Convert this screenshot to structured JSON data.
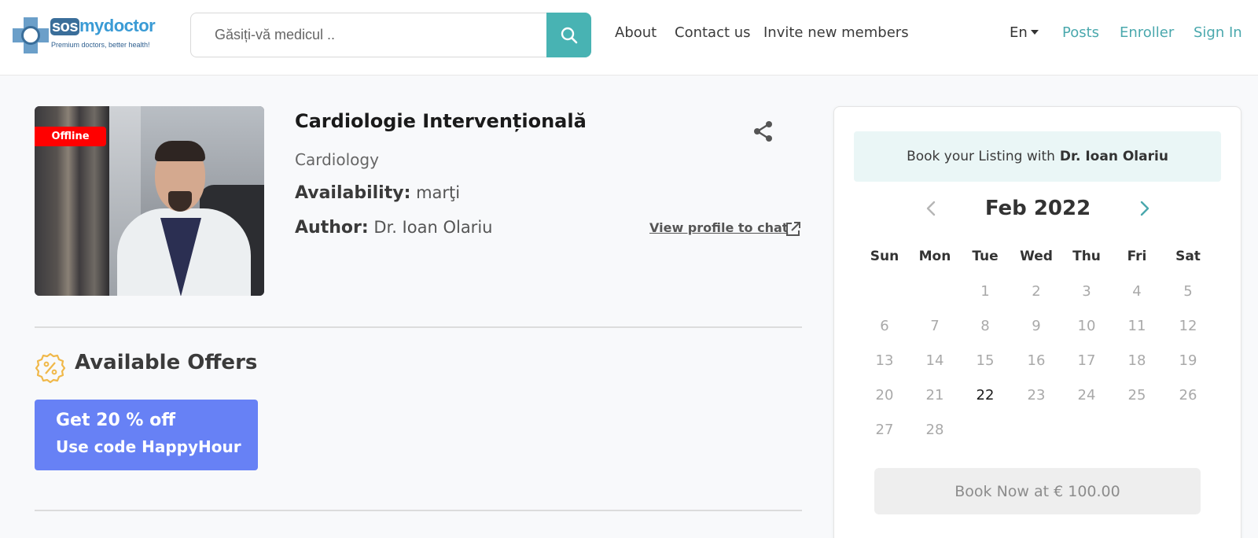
{
  "header": {
    "logo": {
      "brand_sos": "sos",
      "brand_rest": "mydoctor",
      "tagline": "Premium doctors, better health!"
    },
    "search": {
      "placeholder": "Găsiți-vă medicul .."
    },
    "nav": {
      "about": "About",
      "contact": "Contact us",
      "invite": "Invite new members"
    },
    "lang": "En",
    "right_links": {
      "posts": "Posts",
      "enroller": "Enroller",
      "sign_in": "Sign In"
    }
  },
  "listing": {
    "status_badge": "Offline",
    "title": "Cardiologie Intervențională",
    "category": "Cardiology",
    "availability_label": "Availability:",
    "availability_value": "marţi",
    "author_label": "Author:",
    "author_value": "Dr. Ioan Olariu",
    "view_profile": "View profile to chat"
  },
  "offers": {
    "title": "Available Offers",
    "items": [
      {
        "line1": "Get 20 % off",
        "line2": "Use code HappyHour"
      }
    ]
  },
  "booking": {
    "head_text": "Book your Listing with",
    "doctor": "Dr. Ioan Olariu",
    "month": "Feb 2022",
    "weekdays": [
      "Sun",
      "Mon",
      "Tue",
      "Wed",
      "Thu",
      "Fri",
      "Sat"
    ],
    "days": [
      "1",
      "2",
      "3",
      "4",
      "5",
      "6",
      "7",
      "8",
      "9",
      "10",
      "11",
      "12",
      "13",
      "14",
      "15",
      "16",
      "17",
      "18",
      "19",
      "20",
      "21",
      "22",
      "23",
      "24",
      "25",
      "26",
      "27",
      "28"
    ],
    "selected_day": "22",
    "book_button": "Book Now at € 100.00"
  },
  "colors": {
    "accent": "#48b3b3",
    "link": "#4aa8ad",
    "offer": "#6781f5",
    "offline": "#ff0000",
    "offer_icon": "#f0b849"
  },
  "icons": {
    "search": "search-icon",
    "share": "share-icon",
    "external": "external-link-icon",
    "offers": "discount-badge-icon",
    "prev": "chevron-left-icon",
    "next": "chevron-right-icon"
  }
}
